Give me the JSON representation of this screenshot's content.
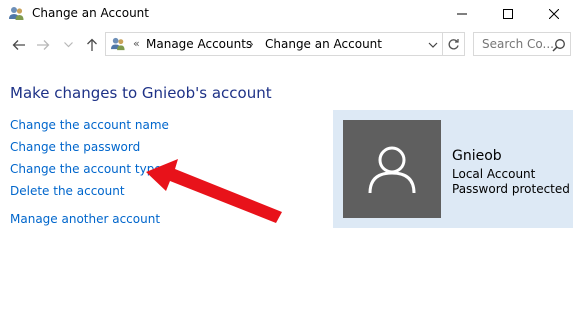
{
  "window": {
    "title": "Change an Account"
  },
  "nav": {
    "breadcrumb_chevron": "«",
    "breadcrumb": [
      "Manage Accounts",
      "Change an Account"
    ],
    "breadcrumb_separator": "›",
    "search_placeholder": "Search Co..."
  },
  "main": {
    "title": "Make changes to Gnieob's account",
    "links": {
      "change_name": "Change the account name",
      "change_password": "Change the password",
      "change_type": "Change the account type",
      "delete": "Delete the account",
      "manage_other": "Manage another account"
    }
  },
  "account": {
    "name": "Gnieob",
    "type": "Local Account",
    "status": "Password protected"
  },
  "colors": {
    "link": "#0066cc",
    "title": "#1e3287",
    "panel_bg": "#dde9f5",
    "avatar_bg": "#5f5f5f",
    "arrow": "#e8121a"
  },
  "icons": [
    "users-icon",
    "minimize-icon",
    "maximize-icon",
    "close-icon",
    "back-arrow-icon",
    "forward-arrow-icon",
    "dropdown-icon",
    "up-arrow-icon",
    "refresh-icon",
    "search-icon",
    "user-avatar-icon",
    "red-pointer-arrow"
  ]
}
